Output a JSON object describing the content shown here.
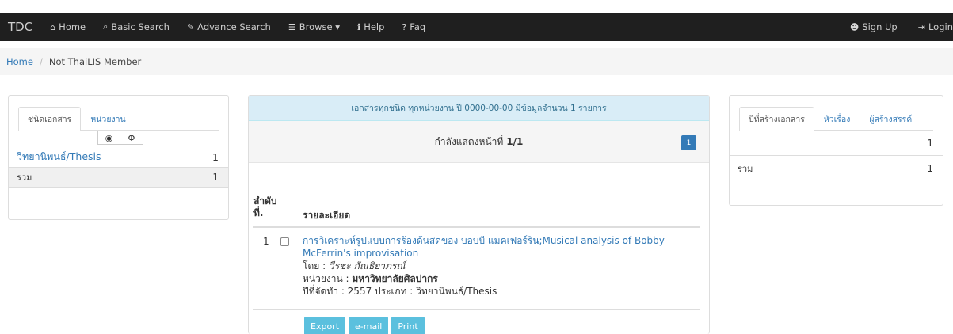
{
  "navbar": {
    "brand": "TDC",
    "items": [
      {
        "icon": "home-icon",
        "glyph": "⌂",
        "label": "Home"
      },
      {
        "icon": "search-icon",
        "glyph": "⌕",
        "label": "Basic Search"
      },
      {
        "icon": "edit-icon",
        "glyph": "✎",
        "label": "Advance Search"
      },
      {
        "icon": "list-icon",
        "glyph": "☰",
        "label": "Browse ▾"
      },
      {
        "icon": "info-icon",
        "glyph": "ℹ",
        "label": "Help"
      },
      {
        "icon": "question-icon",
        "glyph": "?",
        "label": "Faq"
      }
    ],
    "right": [
      {
        "icon": "user-icon",
        "glyph": "☻",
        "label": "Sign Up"
      },
      {
        "icon": "login-icon",
        "glyph": "⇥",
        "label": "Login"
      }
    ]
  },
  "breadcrumb": {
    "home": "Home",
    "separator": "/",
    "current": "Not ThaiLIS Member"
  },
  "left_panel": {
    "tabs": [
      "ชนิดเอกสาร",
      "หน่วยงาน"
    ],
    "active_tab": 0,
    "eye_show": "👁",
    "eye_hide": "⌀",
    "rows": [
      {
        "label": "วิทยานิพนธ์/Thesis",
        "count": "1"
      }
    ],
    "total_label": "รวม",
    "total_count": "1"
  },
  "mid_panel": {
    "header": "เอกสารทุกชนิด ทุกหน่วยงาน ปี 0000-00-00 มีข้อมูลจำนวน 1 รายการ",
    "pager_text": "กำลังแสดงหน้าที่",
    "pager_page": "1/1",
    "page_button": "1",
    "th_no": "ลำดับ ที่.",
    "th_detail": "รายละเอียด",
    "record": {
      "no": "1",
      "title": "การวิเคราะห์รูปแบบการร้องด้นสดของ บอบบี แมคเฟอร์ริน;Musical analysis of Bobby McFerrin's improvisation",
      "author_label": "โดย :",
      "author": "วีรชะ กัณธิยาภรณ์",
      "org_label": "หน่วยงาน :",
      "org": "มหาวิทยาลัยศิลปากร",
      "year_type": "ปีที่จัดทำ : 2557 ประเภท : วิทยานิพนธ์/Thesis"
    },
    "dash": "--",
    "buttons": [
      "Export",
      "e-mail",
      "Print"
    ]
  },
  "right_panel": {
    "tabs": [
      "ปีที่สร้างเอกสาร",
      "หัวเรื่อง",
      "ผู้สร้างสรรค์"
    ],
    "active_tab": 0,
    "row_count": "1",
    "total_label": "รวม",
    "total_count": "1"
  }
}
